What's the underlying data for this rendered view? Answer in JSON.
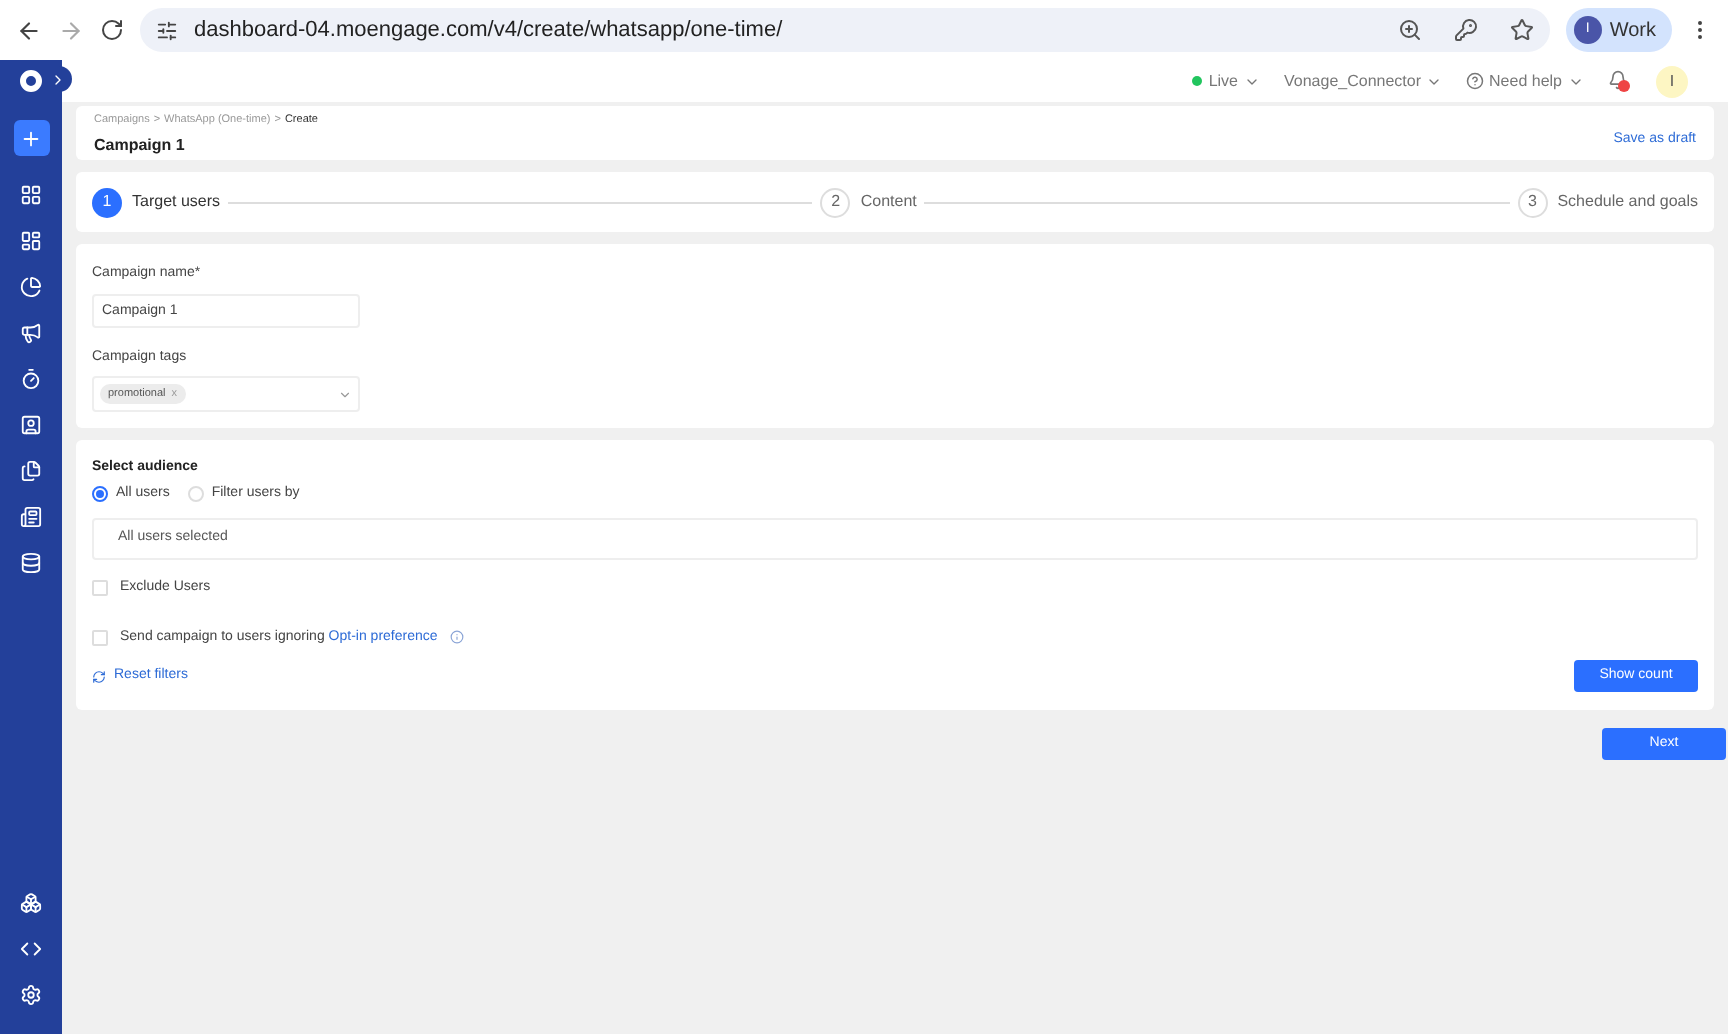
{
  "browser": {
    "url": "dashboard-04.moengage.com/v4/create/whatsapp/one-time/",
    "profile": {
      "initial": "I",
      "label": "Work"
    }
  },
  "topbar": {
    "status": {
      "label": "Live",
      "color": "#22c55e"
    },
    "account": "Vonage_Connector",
    "help": "Need help",
    "avatar": "I"
  },
  "header": {
    "breadcrumb": [
      {
        "label": "Campaigns",
        "selected": false
      },
      {
        "label": "WhatsApp (One-time)",
        "selected": false
      },
      {
        "label": "Create",
        "selected": true
      }
    ],
    "separator": ">",
    "title": "Campaign 1",
    "save_draft": "Save as draft"
  },
  "steps": [
    {
      "number": "1",
      "label": "Target users",
      "selected": true
    },
    {
      "number": "2",
      "label": "Content",
      "selected": false
    },
    {
      "number": "3",
      "label": "Schedule and goals",
      "selected": false
    }
  ],
  "form": {
    "name_label": "Campaign name*",
    "name_value": "Campaign 1",
    "tags_label": "Campaign tags",
    "tags": [
      {
        "label": "promotional",
        "remove": "x"
      }
    ]
  },
  "audience": {
    "title": "Select audience",
    "options": [
      {
        "label": "All users",
        "selected": true
      },
      {
        "label": "Filter users by",
        "selected": false
      }
    ],
    "summary": "All users selected",
    "checkboxes": [
      {
        "label": "Exclude Users",
        "checked": false
      },
      {
        "label": "Send campaign to users ignoring",
        "link": "Opt-in preference",
        "checked": false
      }
    ],
    "reset": "Reset filters",
    "show_count": "Show count"
  },
  "next": "Next"
}
